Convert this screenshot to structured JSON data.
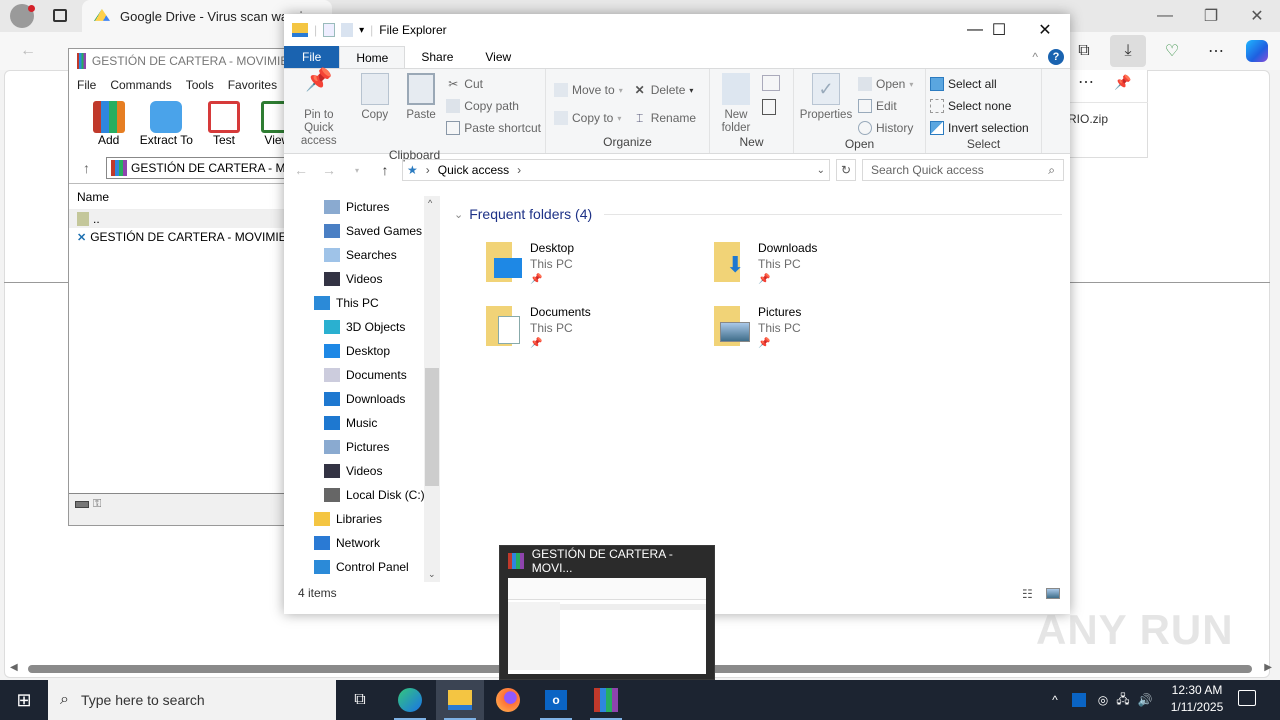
{
  "browser": {
    "tab_title": "Google Drive - Virus scan warni",
    "download_item": "RIO.zip",
    "colors": {
      "copilot": "#1f8ae0"
    }
  },
  "winrar": {
    "title": "GESTIÓN DE CARTERA - MOVIMIEN",
    "menu": [
      "File",
      "Commands",
      "Tools",
      "Favorites"
    ],
    "tools": [
      "Add",
      "Extract To",
      "Test",
      "View"
    ],
    "path": "GESTIÓN DE CARTERA - M",
    "column_name": "Name",
    "rows": [
      "..",
      "GESTIÓN DE CARTERA - MOVIMIENT"
    ]
  },
  "explorer": {
    "title": "File Explorer",
    "tabs": {
      "file": "File",
      "home": "Home",
      "share": "Share",
      "view": "View"
    },
    "ribbon": {
      "clipboard": {
        "label": "Clipboard",
        "pin": "Pin to Quick access",
        "copy": "Copy",
        "paste": "Paste",
        "cut": "Cut",
        "copy_path": "Copy path",
        "paste_shortcut": "Paste shortcut"
      },
      "organize": {
        "label": "Organize",
        "move_to": "Move to",
        "copy_to": "Copy to",
        "delete": "Delete",
        "rename": "Rename"
      },
      "new": {
        "label": "New",
        "new_folder": "New folder"
      },
      "open": {
        "label": "Open",
        "properties": "Properties",
        "open": "Open",
        "edit": "Edit",
        "history": "History"
      },
      "select": {
        "label": "Select",
        "select_all": "Select all",
        "select_none": "Select none",
        "invert": "Invert selection"
      }
    },
    "address": "Quick access",
    "search_placeholder": "Search Quick access",
    "nav": [
      {
        "label": "Pictures",
        "icon": "pictures-icon"
      },
      {
        "label": "Saved Games",
        "icon": "saved-games-icon"
      },
      {
        "label": "Searches",
        "icon": "searches-icon"
      },
      {
        "label": "Videos",
        "icon": "videos-icon"
      },
      {
        "label": "This PC",
        "icon": "this-pc-icon"
      },
      {
        "label": "3D Objects",
        "icon": "3d-objects-icon"
      },
      {
        "label": "Desktop",
        "icon": "desktop-icon"
      },
      {
        "label": "Documents",
        "icon": "documents-icon"
      },
      {
        "label": "Downloads",
        "icon": "downloads-icon"
      },
      {
        "label": "Music",
        "icon": "music-icon"
      },
      {
        "label": "Pictures",
        "icon": "pictures-icon"
      },
      {
        "label": "Videos",
        "icon": "videos-icon"
      },
      {
        "label": "Local Disk (C:)",
        "icon": "local-disk-icon"
      },
      {
        "label": "Libraries",
        "icon": "libraries-icon"
      },
      {
        "label": "Network",
        "icon": "network-icon"
      },
      {
        "label": "Control Panel",
        "icon": "control-panel-icon"
      }
    ],
    "section_title": "Frequent folders (4)",
    "folders": [
      {
        "name": "Desktop",
        "location": "This PC"
      },
      {
        "name": "Downloads",
        "location": "This PC"
      },
      {
        "name": "Documents",
        "location": "This PC"
      },
      {
        "name": "Pictures",
        "location": "This PC"
      }
    ],
    "status": "4 items"
  },
  "taskbar": {
    "search_placeholder": "Type here to search",
    "time": "12:30 AM",
    "date": "1/11/2025",
    "thumbnail_title": "GESTIÓN DE CARTERA - MOVI..."
  },
  "watermark": "ANY RUN"
}
